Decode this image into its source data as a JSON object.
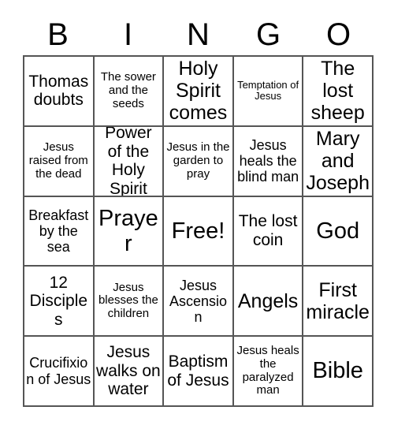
{
  "card": {
    "title_letters": [
      "B",
      "I",
      "N",
      "G",
      "O"
    ],
    "border_color": "#555555",
    "text_color": "#000000",
    "background_color": "#ffffff",
    "rows": 5,
    "columns": 5,
    "free_space_label": "Free!",
    "free_space_position": "center"
  },
  "cells": [
    {
      "text": "Thomas doubts",
      "size": "fs-l"
    },
    {
      "text": "The sower and the seeds",
      "size": "fs-s"
    },
    {
      "text": "Holy Spirit comes",
      "size": "fs-xl"
    },
    {
      "text": "Temptation of Jesus",
      "size": "fs-xs"
    },
    {
      "text": "The lost sheep",
      "size": "fs-xl"
    },
    {
      "text": "Jesus raised from the dead",
      "size": "fs-s"
    },
    {
      "text": "Power of the Holy Spirit",
      "size": "fs-l"
    },
    {
      "text": "Jesus in the garden to pray",
      "size": "fs-s"
    },
    {
      "text": "Jesus heals the blind man",
      "size": "fs-m"
    },
    {
      "text": "Mary and Joseph",
      "size": "fs-xl"
    },
    {
      "text": "Breakfast by the sea",
      "size": "fs-m"
    },
    {
      "text": "Prayer",
      "size": "fs-xxl"
    },
    {
      "text": "Free!",
      "size": "fs-xxl"
    },
    {
      "text": "The lost coin",
      "size": "fs-l"
    },
    {
      "text": "God",
      "size": "fs-xxl"
    },
    {
      "text": "12 Disciples",
      "size": "fs-l"
    },
    {
      "text": "Jesus blesses the children",
      "size": "fs-s"
    },
    {
      "text": "Jesus Ascension",
      "size": "fs-m"
    },
    {
      "text": "Angels",
      "size": "fs-xl"
    },
    {
      "text": "First miracle",
      "size": "fs-xl"
    },
    {
      "text": "Crucifixion of Jesus",
      "size": "fs-m"
    },
    {
      "text": "Jesus walks on water",
      "size": "fs-l"
    },
    {
      "text": "Baptism of Jesus",
      "size": "fs-l"
    },
    {
      "text": "Jesus heals the paralyzed man",
      "size": "fs-s"
    },
    {
      "text": "Bible",
      "size": "fs-xxl"
    }
  ]
}
